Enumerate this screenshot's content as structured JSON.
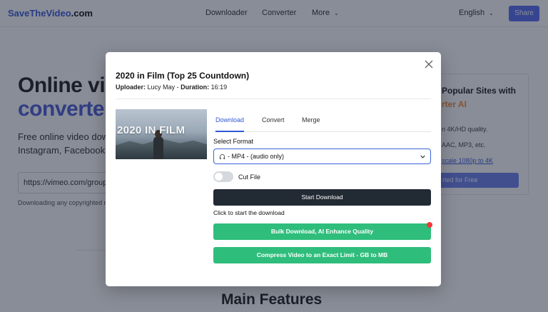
{
  "nav": {
    "logo_part1": "SaveTheVideo",
    "logo_part2": ".com",
    "links": [
      "Downloader",
      "Converter",
      "More"
    ],
    "language": "English",
    "share": "Share"
  },
  "hero": {
    "line1": "Online video",
    "line2": "converter",
    "sub1": "Free online video downloader",
    "sub2": "Instagram, Facebook and",
    "url_value": "https://vimeo.com/groups/",
    "hint": "Downloading any copyrighted material"
  },
  "side": {
    "title": "Popular Sites with",
    "accent": "rter AI",
    "line1": "n 4K/HD quality.",
    "line2": "AAC, MP3, etc.",
    "link": "scale 1080p to 4K",
    "button": "rted for Free"
  },
  "main_features": "Main Features",
  "modal": {
    "title": "2020 in Film (Top 25 Countdown)",
    "uploader_label": "Uploader:",
    "uploader": "Lucy May",
    "separator": "-",
    "duration_label": "Duration:",
    "duration": "16:19",
    "thumb_text": "2020 IN FILM",
    "tabs": [
      "Download",
      "Convert",
      "Merge"
    ],
    "select_label": "Select Format",
    "select_value": "- MP4 - (audio only)",
    "cut_file": "Cut File",
    "start_download": "Start Download",
    "start_hint": "Click to start the download",
    "bulk_download": "Bulk Download, AI Enhance Quality",
    "compress": "Compress Video to an Exact Limit - GB to MB"
  },
  "colors": {
    "accent": "#2f58d6",
    "dark_button": "#222a33",
    "green_button": "#2fbd7c",
    "notification": "#f03a3a",
    "overlay": "rgba(20,28,48,0.5)"
  }
}
